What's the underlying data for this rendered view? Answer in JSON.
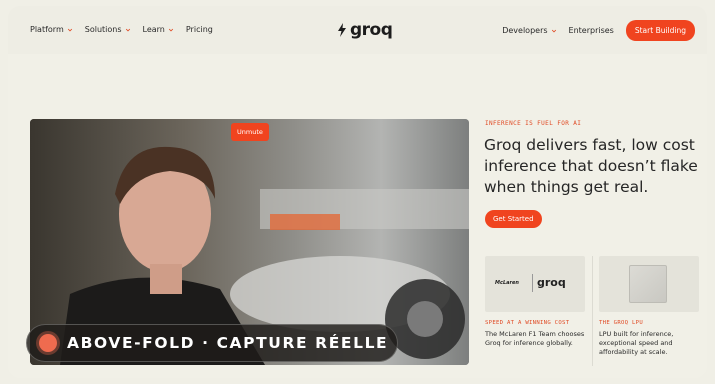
{
  "nav": {
    "left_items": [
      {
        "label": "Platform",
        "dropdown": true
      },
      {
        "label": "Solutions",
        "dropdown": true
      },
      {
        "label": "Learn",
        "dropdown": true
      },
      {
        "label": "Pricing",
        "dropdown": false
      }
    ],
    "logo_text": "groq",
    "right_items": [
      {
        "label": "Developers",
        "dropdown": true
      },
      {
        "label": "Enterprises",
        "dropdown": false
      }
    ],
    "cta_label": "Start Building"
  },
  "video": {
    "unmute_label": "Unmute",
    "caption": "ABOVE-FOLD · CAPTURE RÉELLE"
  },
  "hero": {
    "eyebrow": "INFERENCE IS FUEL FOR AI",
    "headline": "Groq delivers fast, low cost inference that doesn’t flake when things get real.",
    "button_label": "Get Started"
  },
  "cards": [
    {
      "title": "SPEED AT A WINNING COST",
      "desc": "The McLaren F1 Team chooses Groq for inference globally.",
      "logo_left": "McLaren",
      "logo_right": "groq"
    },
    {
      "title": "THE GROQ LPU",
      "desc": "LPU built for inference, exceptional speed and affordability at scale."
    }
  ],
  "colors": {
    "accent": "#f0441f",
    "background": "#f1f0e7",
    "text": "#262626"
  }
}
